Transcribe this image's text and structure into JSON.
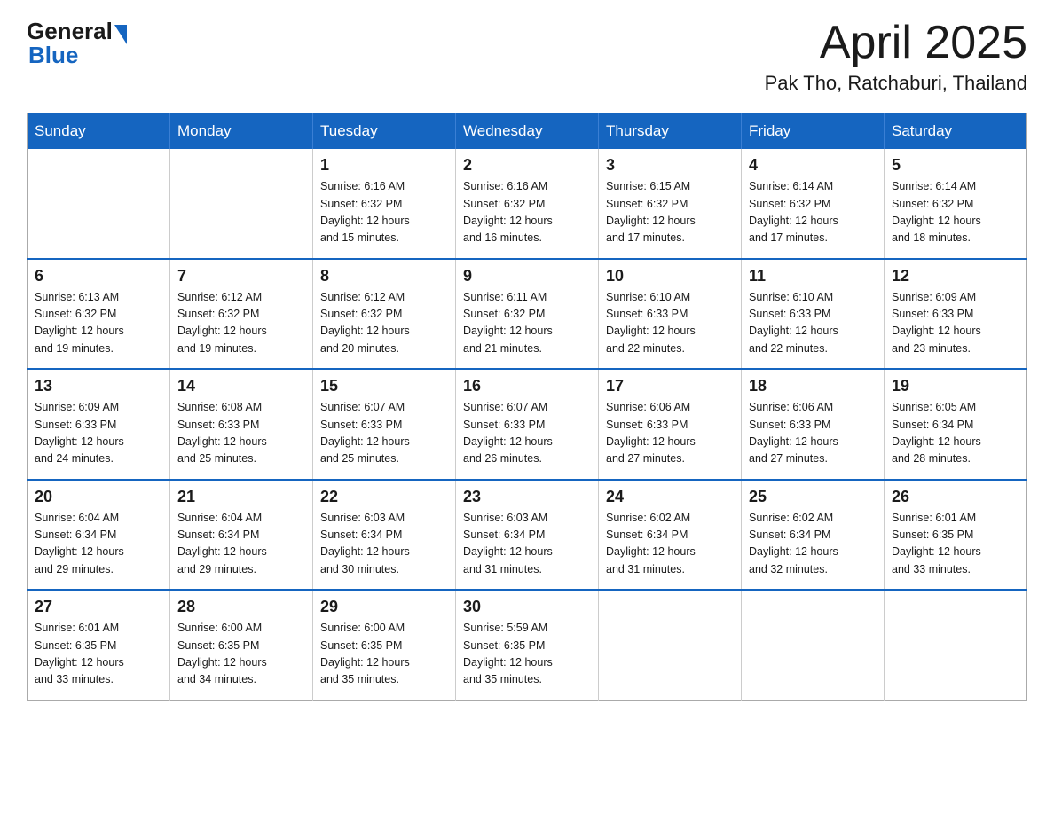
{
  "header": {
    "logo": {
      "general": "General",
      "blue": "Blue"
    },
    "title": "April 2025",
    "location": "Pak Tho, Ratchaburi, Thailand"
  },
  "calendar": {
    "days_of_week": [
      "Sunday",
      "Monday",
      "Tuesday",
      "Wednesday",
      "Thursday",
      "Friday",
      "Saturday"
    ],
    "weeks": [
      [
        {
          "day": "",
          "info": ""
        },
        {
          "day": "",
          "info": ""
        },
        {
          "day": "1",
          "info": "Sunrise: 6:16 AM\nSunset: 6:32 PM\nDaylight: 12 hours\nand 15 minutes."
        },
        {
          "day": "2",
          "info": "Sunrise: 6:16 AM\nSunset: 6:32 PM\nDaylight: 12 hours\nand 16 minutes."
        },
        {
          "day": "3",
          "info": "Sunrise: 6:15 AM\nSunset: 6:32 PM\nDaylight: 12 hours\nand 17 minutes."
        },
        {
          "day": "4",
          "info": "Sunrise: 6:14 AM\nSunset: 6:32 PM\nDaylight: 12 hours\nand 17 minutes."
        },
        {
          "day": "5",
          "info": "Sunrise: 6:14 AM\nSunset: 6:32 PM\nDaylight: 12 hours\nand 18 minutes."
        }
      ],
      [
        {
          "day": "6",
          "info": "Sunrise: 6:13 AM\nSunset: 6:32 PM\nDaylight: 12 hours\nand 19 minutes."
        },
        {
          "day": "7",
          "info": "Sunrise: 6:12 AM\nSunset: 6:32 PM\nDaylight: 12 hours\nand 19 minutes."
        },
        {
          "day": "8",
          "info": "Sunrise: 6:12 AM\nSunset: 6:32 PM\nDaylight: 12 hours\nand 20 minutes."
        },
        {
          "day": "9",
          "info": "Sunrise: 6:11 AM\nSunset: 6:32 PM\nDaylight: 12 hours\nand 21 minutes."
        },
        {
          "day": "10",
          "info": "Sunrise: 6:10 AM\nSunset: 6:33 PM\nDaylight: 12 hours\nand 22 minutes."
        },
        {
          "day": "11",
          "info": "Sunrise: 6:10 AM\nSunset: 6:33 PM\nDaylight: 12 hours\nand 22 minutes."
        },
        {
          "day": "12",
          "info": "Sunrise: 6:09 AM\nSunset: 6:33 PM\nDaylight: 12 hours\nand 23 minutes."
        }
      ],
      [
        {
          "day": "13",
          "info": "Sunrise: 6:09 AM\nSunset: 6:33 PM\nDaylight: 12 hours\nand 24 minutes."
        },
        {
          "day": "14",
          "info": "Sunrise: 6:08 AM\nSunset: 6:33 PM\nDaylight: 12 hours\nand 25 minutes."
        },
        {
          "day": "15",
          "info": "Sunrise: 6:07 AM\nSunset: 6:33 PM\nDaylight: 12 hours\nand 25 minutes."
        },
        {
          "day": "16",
          "info": "Sunrise: 6:07 AM\nSunset: 6:33 PM\nDaylight: 12 hours\nand 26 minutes."
        },
        {
          "day": "17",
          "info": "Sunrise: 6:06 AM\nSunset: 6:33 PM\nDaylight: 12 hours\nand 27 minutes."
        },
        {
          "day": "18",
          "info": "Sunrise: 6:06 AM\nSunset: 6:33 PM\nDaylight: 12 hours\nand 27 minutes."
        },
        {
          "day": "19",
          "info": "Sunrise: 6:05 AM\nSunset: 6:34 PM\nDaylight: 12 hours\nand 28 minutes."
        }
      ],
      [
        {
          "day": "20",
          "info": "Sunrise: 6:04 AM\nSunset: 6:34 PM\nDaylight: 12 hours\nand 29 minutes."
        },
        {
          "day": "21",
          "info": "Sunrise: 6:04 AM\nSunset: 6:34 PM\nDaylight: 12 hours\nand 29 minutes."
        },
        {
          "day": "22",
          "info": "Sunrise: 6:03 AM\nSunset: 6:34 PM\nDaylight: 12 hours\nand 30 minutes."
        },
        {
          "day": "23",
          "info": "Sunrise: 6:03 AM\nSunset: 6:34 PM\nDaylight: 12 hours\nand 31 minutes."
        },
        {
          "day": "24",
          "info": "Sunrise: 6:02 AM\nSunset: 6:34 PM\nDaylight: 12 hours\nand 31 minutes."
        },
        {
          "day": "25",
          "info": "Sunrise: 6:02 AM\nSunset: 6:34 PM\nDaylight: 12 hours\nand 32 minutes."
        },
        {
          "day": "26",
          "info": "Sunrise: 6:01 AM\nSunset: 6:35 PM\nDaylight: 12 hours\nand 33 minutes."
        }
      ],
      [
        {
          "day": "27",
          "info": "Sunrise: 6:01 AM\nSunset: 6:35 PM\nDaylight: 12 hours\nand 33 minutes."
        },
        {
          "day": "28",
          "info": "Sunrise: 6:00 AM\nSunset: 6:35 PM\nDaylight: 12 hours\nand 34 minutes."
        },
        {
          "day": "29",
          "info": "Sunrise: 6:00 AM\nSunset: 6:35 PM\nDaylight: 12 hours\nand 35 minutes."
        },
        {
          "day": "30",
          "info": "Sunrise: 5:59 AM\nSunset: 6:35 PM\nDaylight: 12 hours\nand 35 minutes."
        },
        {
          "day": "",
          "info": ""
        },
        {
          "day": "",
          "info": ""
        },
        {
          "day": "",
          "info": ""
        }
      ]
    ]
  }
}
